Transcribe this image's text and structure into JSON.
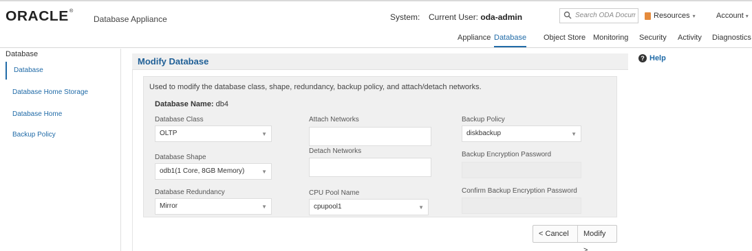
{
  "header": {
    "logo": "ORACLE",
    "logo_mark": "®",
    "app_name": "Database Appliance",
    "system_label": "System:",
    "current_user_label": "Current User:",
    "current_user": "oda-admin",
    "search_placeholder": "Search ODA Documentation for...",
    "resources": "Resources",
    "account": "Account"
  },
  "nav": {
    "appliance": "Appliance",
    "database": "Database",
    "object_store": "Object Store",
    "monitoring": "Monitoring",
    "security": "Security",
    "activity": "Activity",
    "diagnostics": "Diagnostics"
  },
  "sidebar": {
    "title": "Database",
    "items": [
      {
        "label": "Database"
      },
      {
        "label": "Database Home Storage"
      },
      {
        "label": "Database Home"
      },
      {
        "label": "Backup Policy"
      }
    ]
  },
  "main": {
    "title": "Modify Database",
    "description": "Used to modify the database class, shape, redundancy, backup policy, and attach/detach networks.",
    "db_name_label": "Database Name:",
    "db_name": "db4"
  },
  "form": {
    "database_class_label": "Database Class",
    "database_class": "OLTP",
    "database_shape_label": "Database Shape",
    "database_shape": "odb1(1 Core, 8GB Memory)",
    "database_redundancy_label": "Database Redundancy",
    "database_redundancy": "Mirror",
    "attach_networks_label": "Attach Networks",
    "detach_networks_label": "Detach Networks",
    "cpu_pool_label": "CPU Pool Name",
    "cpu_pool": "cpupool1",
    "backup_policy_label": "Backup Policy",
    "backup_policy": "diskbackup",
    "backup_encryption_label": "Backup Encryption Password",
    "confirm_backup_encryption_label": "Confirm Backup Encryption Password"
  },
  "buttons": {
    "cancel": "Cancel",
    "modify": "Modify"
  },
  "help": "Help",
  "colors": {
    "accent": "#1f6aa7",
    "title": "#1f5f96"
  }
}
